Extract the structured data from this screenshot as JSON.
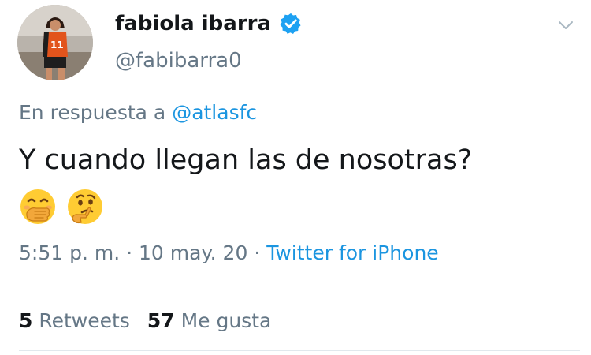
{
  "user": {
    "display_name": "fabiola ibarra",
    "handle": "@fabibarra0",
    "verified": true,
    "avatar_jersey_number": "11"
  },
  "tweet": {
    "reply_prefix": "En respuesta a ",
    "reply_mention": "@atlasfc",
    "text": "Y cuando llegan las de nosotras?",
    "emojis": [
      "face-with-hand-over-mouth",
      "thinking-face"
    ],
    "time": "5:51 p. m.",
    "date": "10 may. 20",
    "separator": " · ",
    "source": "Twitter for iPhone"
  },
  "stats": {
    "retweets_count": "5",
    "retweets_label": " Retweets",
    "likes_count": "57",
    "likes_label": " Me gusta"
  },
  "colors": {
    "accent": "#1b95e0",
    "secondary_text": "#657786",
    "primary_text": "#14171a",
    "divider": "#e1e8ed"
  }
}
